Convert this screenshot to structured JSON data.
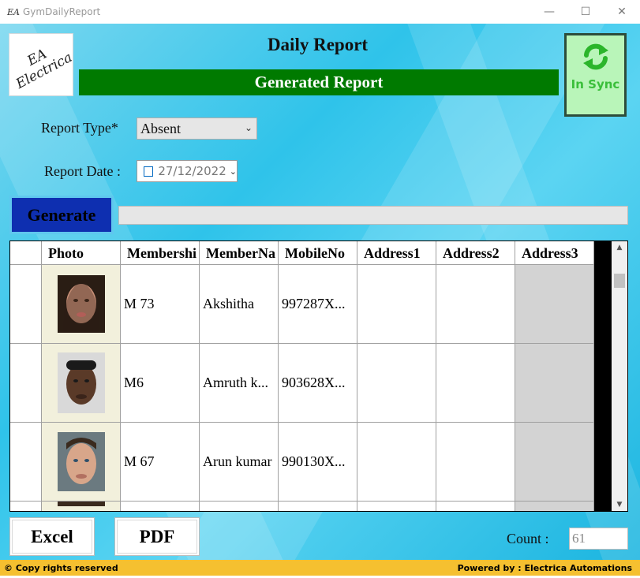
{
  "window": {
    "title": "GymDailyReport",
    "icon_text": "EA",
    "minimize": "—",
    "maximize": "☐",
    "close": "✕"
  },
  "logo": {
    "text": "EA\nElectrica"
  },
  "header": {
    "title": "Daily Report",
    "banner": "Generated Report"
  },
  "sync": {
    "label": "In Sync",
    "color": "#3abf3a"
  },
  "form": {
    "report_type_label": "Report Type*",
    "report_type_value": "Absent",
    "report_date_label": "Report Date :",
    "report_date_value": "27/12/2022"
  },
  "generate_label": "Generate",
  "grid": {
    "columns": [
      "",
      "Photo",
      "Membershi",
      "MemberNa",
      "MobileNo",
      "Address1",
      "Address2",
      "Address3"
    ],
    "rows": [
      {
        "membership": "M 73",
        "name": "Akshitha",
        "mobile": "997287X...",
        "address1": "",
        "address2": "",
        "address3": ""
      },
      {
        "membership": "M6",
        "name": "Amruth k...",
        "mobile": "903628X...",
        "address1": "",
        "address2": "",
        "address3": ""
      },
      {
        "membership": "M 67",
        "name": "Arun kumar",
        "mobile": "990130X...",
        "address1": "",
        "address2": "",
        "address3": ""
      }
    ]
  },
  "footer": {
    "excel_label": "Excel",
    "pdf_label": "PDF",
    "count_label": "Count :",
    "count_value": "61"
  },
  "status": {
    "left": "© Copy rights reserved",
    "right": "Powered by : Electrica Automations"
  },
  "colors": {
    "banner_green": "#007a00",
    "generate_blue": "#0e2fb0",
    "status_yellow": "#f5c030",
    "sync_bg": "#b9f5b9"
  }
}
